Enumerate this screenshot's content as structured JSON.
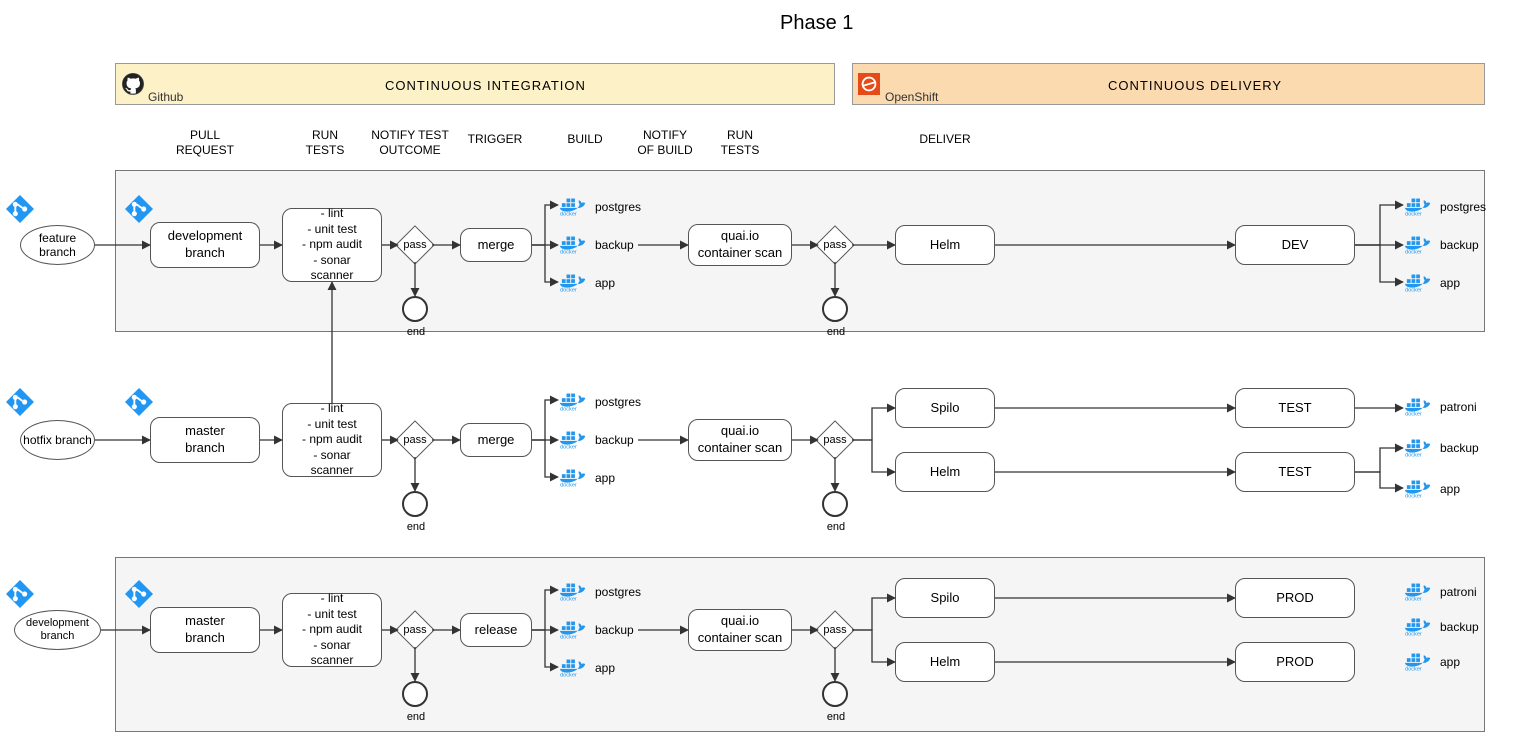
{
  "title": "Phase 1",
  "headers": {
    "ci": "CONTINUOUS INTEGRATION",
    "cd": "CONTINUOUS DELIVERY",
    "github": "Github",
    "openshift": "OpenShift"
  },
  "columns": {
    "pull_request": "PULL\nREQUEST",
    "run_tests1": "RUN\nTESTS",
    "notify_outcome": "NOTIFY  TEST\nOUTCOME",
    "trigger": "TRIGGER",
    "build": "BUILD",
    "notify_build": "NOTIFY\nOF BUILD",
    "run_tests2": "RUN\nTESTS",
    "deliver": "DELIVER"
  },
  "nodes": {
    "feature_branch": "feature\nbranch",
    "hotfix_branch": "hotfix\nbranch",
    "development_branch_start": "development\nbranch",
    "development_branch": "development\nbranch",
    "master_branch": "master\nbranch",
    "tests": "- lint\n- unit test\n- npm audit\n- sonar scanner",
    "pass": "pass",
    "merge": "merge",
    "release": "release",
    "quay": "quai.io\ncontainer scan",
    "helm": "Helm",
    "spilo": "Spilo",
    "dev": "DEV",
    "test": "TEST",
    "prod": "PROD",
    "end": "end"
  },
  "artifacts": {
    "postgres": "postgres",
    "backup": "backup",
    "app": "app",
    "patroni": "patroni"
  },
  "icons": {
    "github": "github-icon",
    "openshift": "openshift-icon",
    "git": "git-icon",
    "docker": "docker-icon"
  }
}
